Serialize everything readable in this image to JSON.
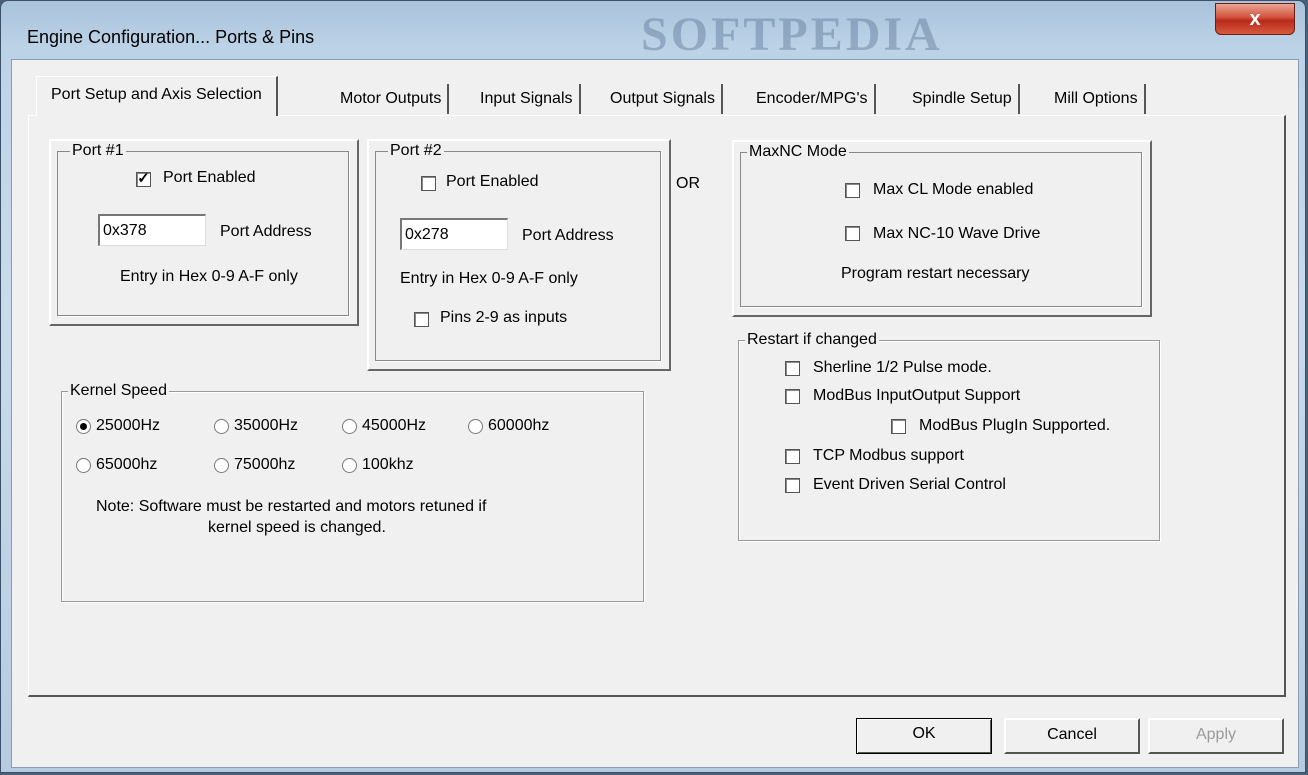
{
  "window": {
    "title": "Engine Configuration... Ports & Pins",
    "watermark": "SOFTPEDIA",
    "close_label": "x"
  },
  "tabs": [
    {
      "label": "Port Setup and Axis Selection",
      "active": true
    },
    {
      "label": "Motor Outputs"
    },
    {
      "label": "Input Signals"
    },
    {
      "label": "Output Signals"
    },
    {
      "label": "Encoder/MPG's"
    },
    {
      "label": "Spindle Setup"
    },
    {
      "label": "Mill Options"
    }
  ],
  "port1": {
    "legend": "Port #1",
    "enabled_label": "Port Enabled",
    "enabled_checked": true,
    "address_value": "0x378",
    "address_label": "Port Address",
    "hint": "Entry in Hex 0-9 A-F only"
  },
  "port2": {
    "legend": "Port #2",
    "enabled_label": "Port Enabled",
    "enabled_checked": false,
    "address_value": "0x278",
    "address_label": "Port Address",
    "hint": "Entry in Hex 0-9 A-F only",
    "pins_label": "Pins 2-9 as inputs",
    "pins_checked": false
  },
  "or_label": "OR",
  "maxnc": {
    "legend": "MaxNC Mode",
    "cl_label": "Max CL Mode enabled",
    "wave_label": "Max NC-10 Wave Drive",
    "note": "Program restart necessary"
  },
  "restart": {
    "legend": "Restart if changed",
    "sherline_label": "Sherline 1/2 Pulse mode.",
    "modbus_label": "ModBus InputOutput Support",
    "plugin_label": "ModBus PlugIn Supported.",
    "tcp_label": "TCP Modbus support",
    "serial_label": "Event Driven Serial Control"
  },
  "kernel": {
    "legend": "Kernel Speed",
    "options": [
      "25000Hz",
      "35000Hz",
      "45000Hz",
      "60000hz",
      "65000hz",
      "75000hz",
      "100khz"
    ],
    "selected": "25000Hz",
    "note_line1": "Note: Software must be restarted and motors retuned if",
    "note_line2": "kernel speed is changed."
  },
  "buttons": {
    "ok": "OK",
    "cancel": "Cancel",
    "apply": "Apply"
  }
}
